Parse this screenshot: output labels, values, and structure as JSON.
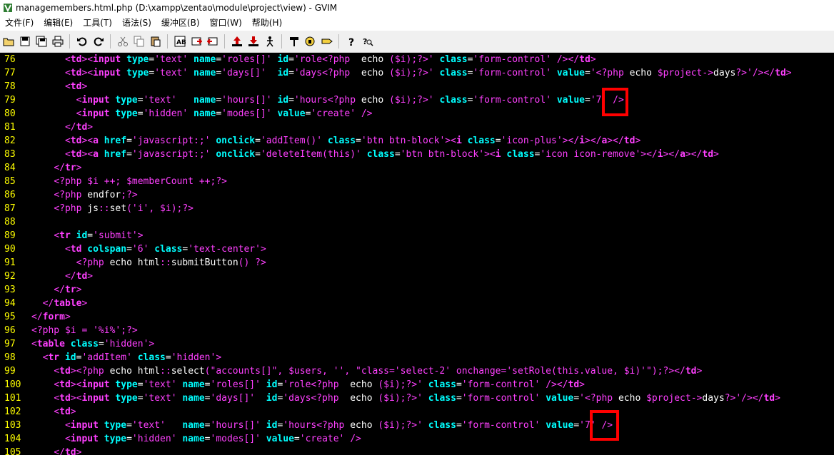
{
  "window": {
    "title": "managemembers.html.php (D:\\xampp\\zentao\\module\\project\\view) - GVIM"
  },
  "menu": [
    {
      "label": "文件(F)"
    },
    {
      "label": "编辑(E)"
    },
    {
      "label": "工具(T)"
    },
    {
      "label": "语法(S)"
    },
    {
      "label": "缓冲区(B)"
    },
    {
      "label": "窗口(W)"
    },
    {
      "label": "帮助(H)"
    }
  ],
  "toolbar": {
    "icons": [
      "open-icon",
      "save-icon",
      "save-all-icon",
      "print-icon",
      "undo-icon",
      "redo-icon",
      "cut-icon",
      "copy-icon",
      "paste-icon",
      "find-replace-icon",
      "find-next-icon",
      "find-prev-icon",
      "load-session-icon",
      "save-session-icon",
      "run-script-icon",
      "make-icon",
      "shell-icon",
      "ctags-icon",
      "help-icon",
      "find-help-icon"
    ]
  },
  "editor": {
    "lines": [
      {
        "num": "76",
        "text": "      <td><input type='text' name='roles[]' id='role<?php  echo ($i);?>' class='form-control' /></td>"
      },
      {
        "num": "77",
        "text": "      <td><input type='text' name='days[]'  id='days<?php  echo ($i);?>' class='form-control' value='<?php echo $project->days?>'/></td>"
      },
      {
        "num": "78",
        "text": "      <td>"
      },
      {
        "num": "79",
        "text": "        <input type='text'   name='hours[]' id='hours<?php echo ($i);?>' class='form-control' value='7' />"
      },
      {
        "num": "80",
        "text": "        <input type='hidden' name='modes[]' value='create' />"
      },
      {
        "num": "81",
        "text": "      </td>"
      },
      {
        "num": "82",
        "text": "      <td><a href='javascript:;' onclick='addItem()' class='btn btn-block'><i class='icon-plus'></i></a></td>"
      },
      {
        "num": "83",
        "text": "      <td><a href='javascript:;' onclick='deleteItem(this)' class='btn btn-block'><i class='icon icon-remove'></i></a></td>"
      },
      {
        "num": "84",
        "text": "    </tr>"
      },
      {
        "num": "85",
        "text": "    <?php $i ++; $memberCount ++;?>"
      },
      {
        "num": "86",
        "text": "    <?php endfor;?>"
      },
      {
        "num": "87",
        "text": "    <?php js::set('i', $i);?>"
      },
      {
        "num": "88",
        "text": ""
      },
      {
        "num": "89",
        "text": "    <tr id='submit'>"
      },
      {
        "num": "90",
        "text": "      <td colspan='6' class='text-center'>"
      },
      {
        "num": "91",
        "text": "        <?php echo html::submitButton() ?>"
      },
      {
        "num": "92",
        "text": "      </td>"
      },
      {
        "num": "93",
        "text": "    </tr>"
      },
      {
        "num": "94",
        "text": "  </table>"
      },
      {
        "num": "95",
        "text": "</form>"
      },
      {
        "num": "96",
        "text": "<?php $i = '%i%';?>"
      },
      {
        "num": "97",
        "text": "<table class='hidden'>"
      },
      {
        "num": "98",
        "text": "  <tr id='addItem' class='hidden'>"
      },
      {
        "num": "99",
        "text": "    <td><?php echo html::select(\"accounts[]\", $users, '', \"class='select-2' onchange='setRole(this.value, $i)'\");?></td>"
      },
      {
        "num": "100",
        "text": "    <td><input type='text' name='roles[]' id='role<?php  echo ($i);?>' class='form-control' /></td>"
      },
      {
        "num": "101",
        "text": "    <td><input type='text' name='days[]'  id='days<?php  echo ($i);?>' class='form-control' value='<?php echo $project->days?>'/></td>"
      },
      {
        "num": "102",
        "text": "    <td>"
      },
      {
        "num": "103",
        "text": "      <input type='text'   name='hours[]' id='hours<?php echo ($i);?>' class='form-control' value='7' />"
      },
      {
        "num": "104",
        "text": "      <input type='hidden' name='modes[]' value='create' />"
      },
      {
        "num": "105",
        "text": "    </td>"
      }
    ]
  },
  "colors": {
    "background": "#000000",
    "line_number": "#ffff00",
    "tag": "#ff40ff",
    "attribute": "#00ffff",
    "plain": "#ffffff",
    "highlight_box": "#ff0000"
  }
}
